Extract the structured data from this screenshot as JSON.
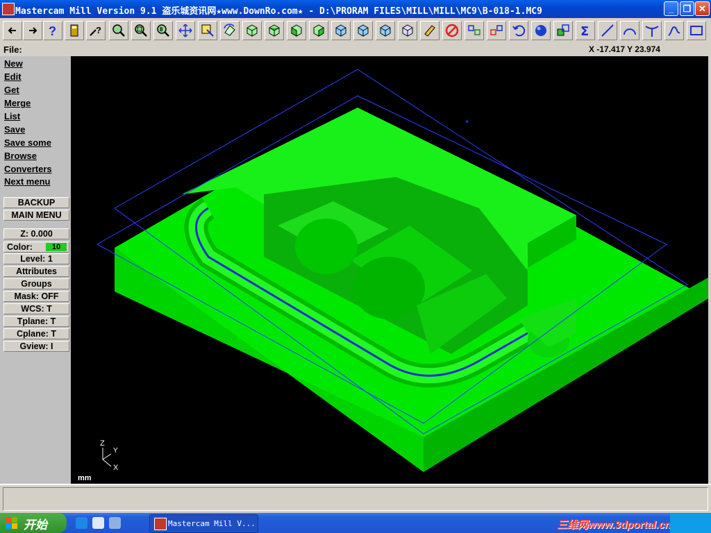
{
  "window": {
    "title": "Mastercam Mill Version 9.1 盗乐城资讯网★www.DownRo.com★ - D:\\PRORAM FILES\\MILL\\MILL\\MC9\\B-018-1.MC9",
    "controls": {
      "minimize": "_",
      "maximize": "❐",
      "close": "✕"
    }
  },
  "toolbar": {
    "buttons": [
      "back-arrow-icon",
      "forward-arrow-icon",
      "help-icon",
      "calculator-icon",
      "what-is-icon",
      "zoom-in-icon",
      "zoom-window-icon",
      "zoom-extents-icon",
      "pan-icon",
      "select-icon",
      "rotate-view-icon",
      "view-iso-icon",
      "view-top-icon",
      "view-front-icon",
      "view-side-icon",
      "view-cube-1-icon",
      "view-cube-2-icon",
      "view-cube-3-icon",
      "view-cube-4-icon",
      "eraser-icon",
      "no-delete-icon",
      "transform-1-icon",
      "transform-2-icon",
      "undo-icon",
      "shade-sphere-icon",
      "transform-3-icon",
      "sum-icon",
      "line-icon",
      "arc-icon",
      "fillet-icon",
      "spline-icon",
      "rectangle-icon"
    ]
  },
  "file_line": {
    "label": "File:",
    "coordinates": "X -17.417  Y 23.974"
  },
  "menu": {
    "items": [
      "New",
      "Edit",
      "Get",
      "Merge",
      "List",
      "Save",
      "Save some",
      "Browse",
      "Converters",
      "Next menu"
    ],
    "backup": "BACKUP",
    "main_menu": "MAIN MENU",
    "z": "Z:  0.000",
    "color_label": "Color:",
    "color_value": "10",
    "level": "Level:  1",
    "attributes": "Attributes",
    "groups": "Groups",
    "mask": "Mask:  OFF",
    "wcs": "WCS:   T",
    "tplane": "Tplane:  T",
    "cplane": "Cplane:  T",
    "gview": "Gview:   I"
  },
  "viewport": {
    "units": "mm",
    "axes": {
      "z": "Z",
      "y": "Y",
      "x": "X"
    },
    "colors": {
      "part": "#00ee00",
      "boundary": "#2b3fff",
      "background": "#000000"
    }
  },
  "taskbar": {
    "start": "开始",
    "task": "Mastercam Mill V...",
    "watermark": "三维网www.3dportal.cn"
  }
}
